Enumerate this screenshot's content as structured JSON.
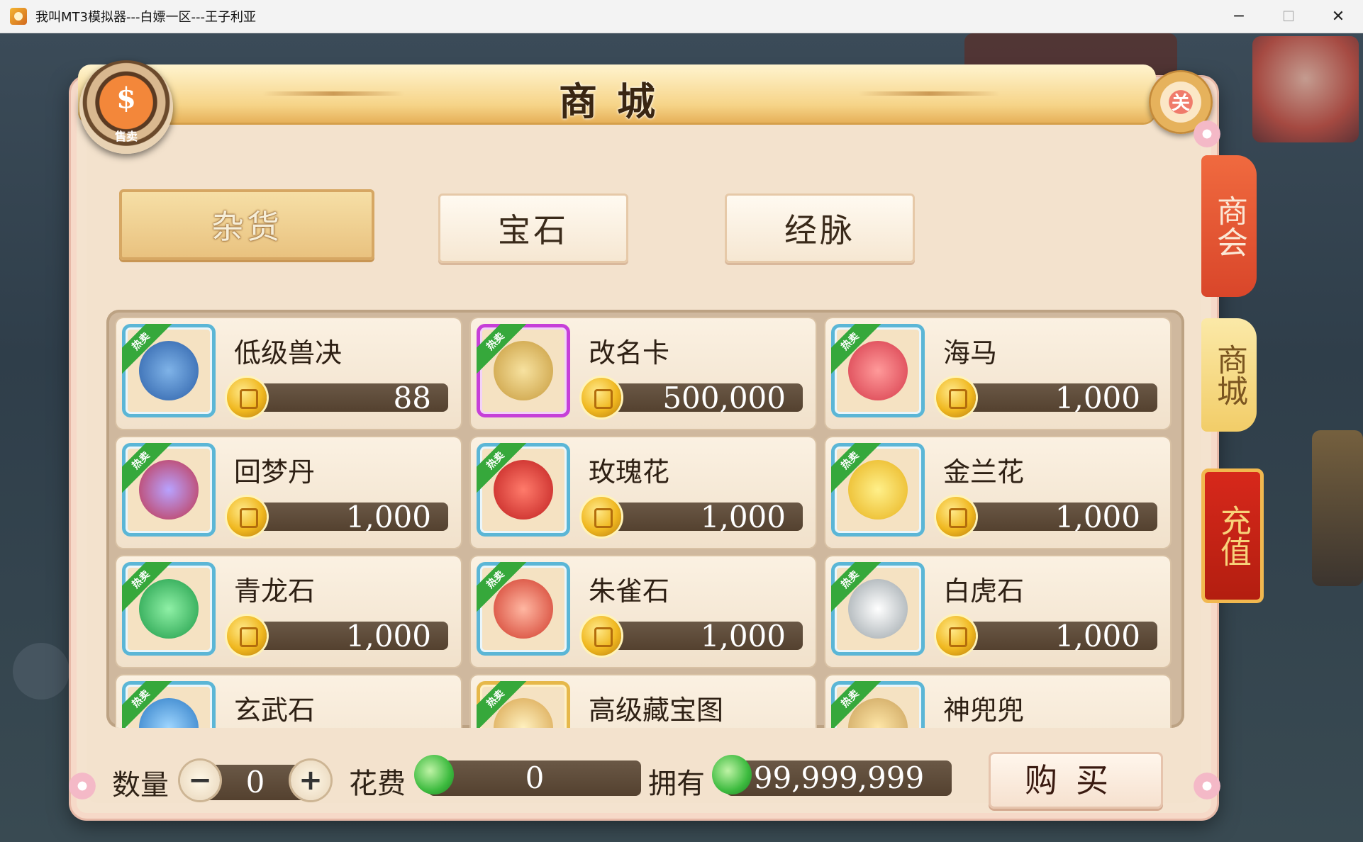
{
  "window": {
    "title": "我叫MT3模拟器---白嫖一区---王子利亚",
    "minimize": "─",
    "maximize": "☐",
    "close": "✕"
  },
  "shop": {
    "title": "商城",
    "sell_badge": {
      "glyph": "$",
      "label": "售卖"
    },
    "close_badge": "关",
    "tabs": [
      {
        "label": "杂货",
        "active": true
      },
      {
        "label": "宝石",
        "active": false
      },
      {
        "label": "经脉",
        "active": false
      }
    ],
    "items": [
      {
        "name": "低级兽决",
        "price": "88",
        "hot": "热卖",
        "icon": "skill-book-icon",
        "frame": "blue"
      },
      {
        "name": "改名卡",
        "price": "500,000",
        "hot": "热卖",
        "icon": "scroll-icon",
        "frame": "purple"
      },
      {
        "name": "海马",
        "price": "1,000",
        "hot": "热卖",
        "icon": "seahorse-icon",
        "frame": "blue"
      },
      {
        "name": "回梦丹",
        "price": "1,000",
        "hot": "热卖",
        "icon": "treasure-chest-icon",
        "frame": "blue"
      },
      {
        "name": "玫瑰花",
        "price": "1,000",
        "hot": "热卖",
        "icon": "rose-icon",
        "frame": "blue"
      },
      {
        "name": "金兰花",
        "price": "1,000",
        "hot": "热卖",
        "icon": "orchid-icon",
        "frame": "blue"
      },
      {
        "name": "青龙石",
        "price": "1,000",
        "hot": "热卖",
        "icon": "green-dragon-stone-icon",
        "frame": "blue"
      },
      {
        "name": "朱雀石",
        "price": "1,000",
        "hot": "热卖",
        "icon": "vermilion-bird-stone-icon",
        "frame": "blue"
      },
      {
        "name": "白虎石",
        "price": "1,000",
        "hot": "热卖",
        "icon": "white-tiger-stone-icon",
        "frame": "blue"
      },
      {
        "name": "玄武石",
        "price": "",
        "hot": "热卖",
        "icon": "black-tortoise-stone-icon",
        "frame": "blue"
      },
      {
        "name": "高级藏宝图",
        "price": "",
        "hot": "热卖",
        "icon": "treasure-map-icon",
        "frame": "gold"
      },
      {
        "name": "神兜兜",
        "price": "",
        "hot": "热卖",
        "icon": "pouch-icon",
        "frame": "blue"
      }
    ],
    "side_tabs": {
      "guild": "商会",
      "mall": "商城",
      "recharge": "充值"
    },
    "bottom": {
      "quantity_label": "数量",
      "quantity_value": "0",
      "minus": "−",
      "plus": "+",
      "cost_label": "花费",
      "cost_value": "0",
      "owned_label": "拥有",
      "owned_value": "99,999,999",
      "buy_label": "购买"
    }
  },
  "colors": {
    "accent_green": "#36a83b",
    "price_bar": "#54412f",
    "recharge_red": "#d7281b"
  }
}
